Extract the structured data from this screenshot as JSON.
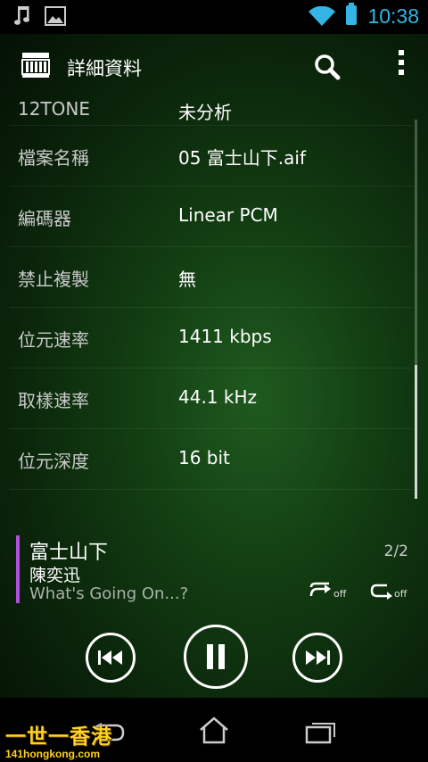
{
  "status_bar": {
    "time": "10:38",
    "accent_color": "#33b5e5"
  },
  "action_bar": {
    "title": "詳細資料"
  },
  "details": [
    {
      "label": "12TONE",
      "value": "未分析"
    },
    {
      "label": "檔案名稱",
      "value": "05 富士山下.aif"
    },
    {
      "label": "編碼器",
      "value": "Linear PCM"
    },
    {
      "label": "禁止複製",
      "value": "無"
    },
    {
      "label": "位元速率",
      "value": "1411 kbps"
    },
    {
      "label": "取樣速率",
      "value": "44.1 kHz"
    },
    {
      "label": "位元深度",
      "value": "16 bit"
    }
  ],
  "now_playing": {
    "track": "富士山下",
    "artist": "陳奕迅",
    "album": "What's Going On...?",
    "counter": "2/2",
    "shuffle_label": "off",
    "repeat_label": "off",
    "accent_color": "#b050d8"
  },
  "watermark": {
    "main": "一世一香港",
    "sub": "141hongkong.com"
  }
}
